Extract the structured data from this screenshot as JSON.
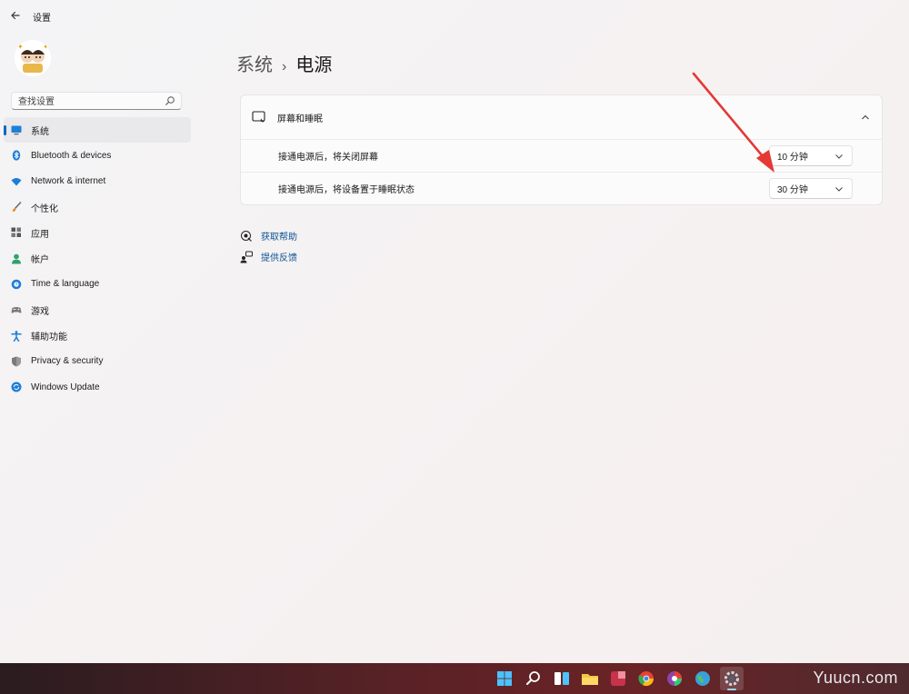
{
  "app": {
    "title": "设置"
  },
  "search": {
    "placeholder": "查找设置"
  },
  "sidebar": {
    "items": [
      {
        "label": "系统",
        "icon": "monitor-icon",
        "active": true
      },
      {
        "label": "Bluetooth & devices",
        "icon": "bluetooth-icon"
      },
      {
        "label": "Network & internet",
        "icon": "wifi-icon"
      },
      {
        "label": "个性化",
        "icon": "brush-icon"
      },
      {
        "label": "应用",
        "icon": "apps-icon"
      },
      {
        "label": "帐户",
        "icon": "person-icon"
      },
      {
        "label": "Time & language",
        "icon": "globe-clock-icon"
      },
      {
        "label": "游戏",
        "icon": "gamepad-icon"
      },
      {
        "label": "辅助功能",
        "icon": "accessibility-icon"
      },
      {
        "label": "Privacy & security",
        "icon": "shield-icon"
      },
      {
        "label": "Windows Update",
        "icon": "update-icon"
      }
    ]
  },
  "breadcrumb": {
    "parent": "系统",
    "separator": "›",
    "current": "电源"
  },
  "card": {
    "title": "屏幕和睡眠",
    "rows": [
      {
        "label": "接通电源后，将关闭屏幕",
        "value": "10 分钟"
      },
      {
        "label": "接通电源后，将设备置于睡眠状态",
        "value": "30 分钟"
      }
    ]
  },
  "links": {
    "help": "获取帮助",
    "feedback": "提供反馈"
  },
  "watermark": "Yuucn.com",
  "colors": {
    "accent": "#0067c0",
    "annotation_arrow": "#e53935"
  }
}
